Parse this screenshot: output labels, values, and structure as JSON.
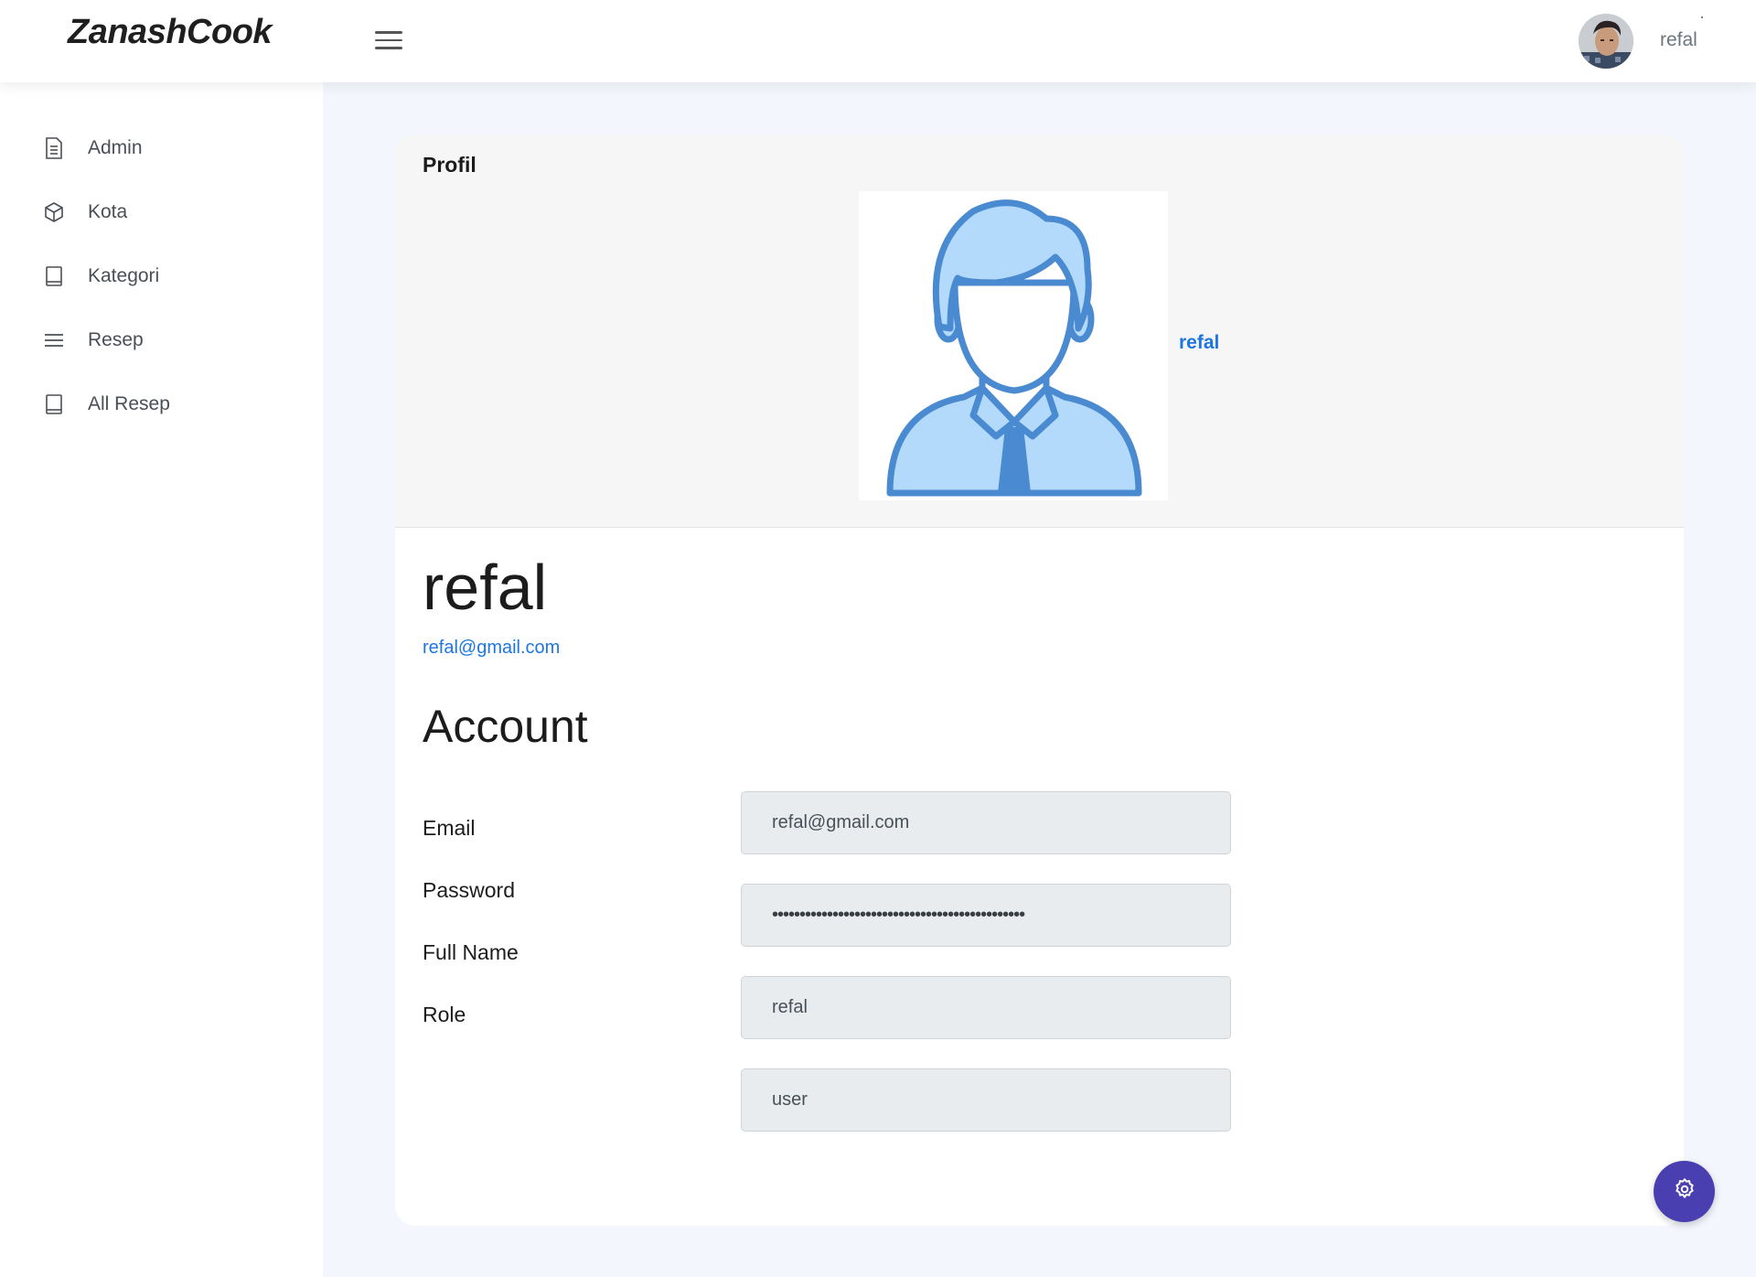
{
  "navbar": {
    "brand": "ZanashCook",
    "user_name": "refal"
  },
  "sidebar": {
    "items": [
      {
        "label": "Admin",
        "icon": "document-icon"
      },
      {
        "label": "Kota",
        "icon": "cube-icon"
      },
      {
        "label": "Kategori",
        "icon": "book-icon"
      },
      {
        "label": "Resep",
        "icon": "menu-lines-icon"
      },
      {
        "label": "All Resep",
        "icon": "book-icon"
      }
    ]
  },
  "profile": {
    "card_title": "Profil",
    "image_link": "refal",
    "name": "refal",
    "email": "refal@gmail.com"
  },
  "account": {
    "title": "Account",
    "labels": {
      "email": "Email",
      "password": "Password",
      "full_name": "Full Name",
      "role": "Role"
    },
    "values": {
      "email": "refal@gmail.com",
      "password": "••••••••••••••••••••••••••••••••••••••••••••••",
      "full_name": "refal",
      "role": "user"
    }
  },
  "colors": {
    "brand_blue": "#1d76e2",
    "fab_purple": "#4a3fb0",
    "page_bg": "#f4f6fd",
    "input_bg": "#e9ecef"
  }
}
